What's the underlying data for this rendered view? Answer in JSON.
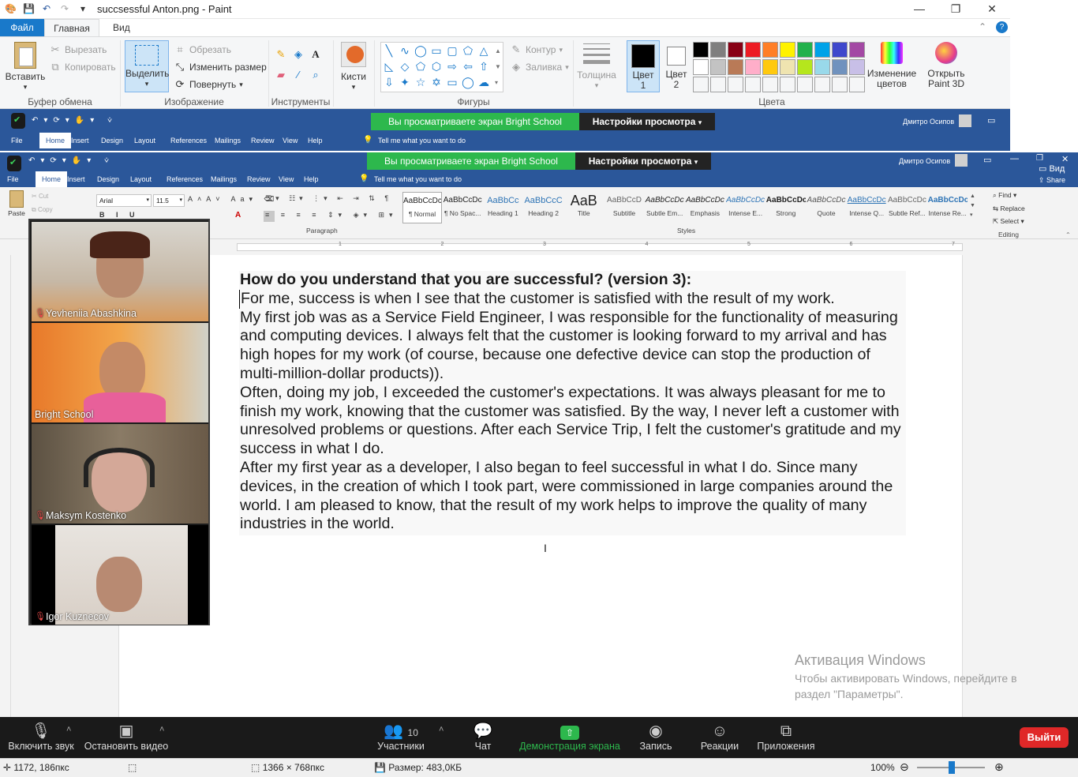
{
  "paint": {
    "title": "succsessful Anton.png - Paint",
    "tabs": {
      "file": "Файл",
      "home": "Главная",
      "view": "Вид"
    },
    "clipboard": {
      "paste": "Вставить",
      "cut": "Вырезать",
      "copy": "Копировать",
      "label": "Буфер обмена"
    },
    "image": {
      "select": "Выделить",
      "crop": "Обрезать",
      "resize": "Изменить размер",
      "rotate": "Повернуть",
      "label": "Изображение"
    },
    "tools": {
      "label": "Инструменты"
    },
    "brushes": "Кисти",
    "shapes": {
      "outline": "Контур",
      "fill": "Заливка",
      "label": "Фигуры"
    },
    "thickness": "Толщина",
    "color1": {
      "line1": "Цвет",
      "line2": "1"
    },
    "color2": {
      "line1": "Цвет",
      "line2": "2"
    },
    "colors_label": "Цвета",
    "edit_colors": {
      "line1": "Изменение",
      "line2": "цветов"
    },
    "open3d": {
      "line1": "Открыть",
      "line2": "Paint 3D"
    },
    "palette": [
      "#000000",
      "#7f7f7f",
      "#880015",
      "#ed1c24",
      "#ff7f27",
      "#fff200",
      "#22b14c",
      "#00a2e8",
      "#3f48cc",
      "#a349a4",
      "#ffffff",
      "#c3c3c3",
      "#b97a57",
      "#ffaec9",
      "#ffc90e",
      "#efe4b0",
      "#b5e61d",
      "#99d9ea",
      "#7092be",
      "#c8bfe7"
    ]
  },
  "word_back": {
    "share_notice": "Вы просматриваете экран Bright School",
    "view_options": "Настройки просмотра",
    "user": "Дмитро Осипов",
    "tabs": [
      "File",
      "Home",
      "Insert",
      "Design",
      "Layout",
      "References",
      "Mailings",
      "Review",
      "View",
      "Help"
    ],
    "tell_me": "Tell me what you want to do"
  },
  "word": {
    "share_notice": "Вы просматриваете экран Bright School",
    "view_options": "Настройки просмотра",
    "user": "Дмитро Осипов",
    "view_btn": "Вид",
    "share_btn": "Share",
    "tabs": [
      "File",
      "Home",
      "Insert",
      "Design",
      "Layout",
      "References",
      "Mailings",
      "Review",
      "View",
      "Help"
    ],
    "tell_me": "Tell me what you want to do",
    "clipboard": {
      "paste": "Paste",
      "cut": "Cut",
      "copy": "Copy"
    },
    "font": {
      "name": "Arial",
      "size": "11.5"
    },
    "paragraph_label": "Paragraph",
    "styles_label": "Styles",
    "editing_label": "Editing",
    "styles": [
      {
        "preview": "AaBbCcDc",
        "name": "¶ Normal"
      },
      {
        "preview": "AaBbCcDc",
        "name": "¶ No Spac..."
      },
      {
        "preview": "AaBbCc",
        "name": "Heading 1"
      },
      {
        "preview": "AaBbCcC",
        "name": "Heading 2"
      },
      {
        "preview": "AaB",
        "name": "Title"
      },
      {
        "preview": "AaBbCcD",
        "name": "Subtitle"
      },
      {
        "preview": "AaBbCcDc",
        "name": "Subtle Em..."
      },
      {
        "preview": "AaBbCcDc",
        "name": "Emphasis"
      },
      {
        "preview": "AaBbCcDc",
        "name": "Intense E..."
      },
      {
        "preview": "AaBbCcDc",
        "name": "Strong"
      },
      {
        "preview": "AaBbCcDc",
        "name": "Quote"
      },
      {
        "preview": "AaBbCcDc",
        "name": "Intense Q..."
      },
      {
        "preview": "AaBbCcDc",
        "name": "Subtle Ref..."
      },
      {
        "preview": "AaBbCcDc",
        "name": "Intense Re..."
      }
    ],
    "editing": {
      "find": "Find",
      "replace": "Replace",
      "select": "Select"
    },
    "ruler_numbers": [
      "1",
      "2",
      "3",
      "4",
      "5",
      "6",
      "7"
    ]
  },
  "document": {
    "heading": "How do you understand that you are successful? (version 3):",
    "paragraphs": [
      "For me, success is when I see that the customer is satisfied with the result of my work.",
      "My first job was as a Service Field Engineer, I was responsible for the functionality of measuring and computing devices. I always felt that the customer is looking forward to my arrival and has high hopes for my work (of course, because one defective device can stop the production of multi-million-dollar products)).",
      "Often, doing my job, I exceeded the customer's expectations. It was always pleasant for me to finish my work, knowing that the customer was satisfied. By the way, I never left a customer with unresolved problems or questions. After each Service Trip, I felt the customer's gratitude and my success in what I do.",
      "After my first year as a developer, I also began to feel successful in what I do. Since many devices, in the creation of which I took part, were commissioned in large companies around the world. I am pleased to know, that the result of my work helps to improve the quality of many industries in the world."
    ]
  },
  "watermark": {
    "title": "Активация Windows",
    "line1": "Чтобы активировать Windows, перейдите в",
    "line2": "раздел \"Параметры\"."
  },
  "participants": [
    {
      "name": "Yevheniia Abashkina",
      "muted": true
    },
    {
      "name": "Bright School",
      "muted": false
    },
    {
      "name": "Maksym Kostenko",
      "muted": true
    },
    {
      "name": "Igor Kuznecov",
      "muted": true
    }
  ],
  "zoom_bar": {
    "unmute": "Включить звук",
    "stop_video": "Остановить видео",
    "participants": "Участники",
    "participants_count": "10",
    "chat": "Чат",
    "share_screen": "Демонстрация экрана",
    "record": "Запись",
    "reactions": "Реакции",
    "apps": "Приложения",
    "leave": "Выйти"
  },
  "status": {
    "cursor_pos": "1172, 186пкс",
    "dimensions": "1366 × 768пкс",
    "size": "Размер: 483,0КБ",
    "zoom": "100%"
  },
  "colors": {
    "paint_accent": "#1979ca",
    "word_blue": "#2b579a",
    "share_green": "#2db84d",
    "zoom_bg": "#1a1a1a",
    "leave_red": "#e02828"
  }
}
